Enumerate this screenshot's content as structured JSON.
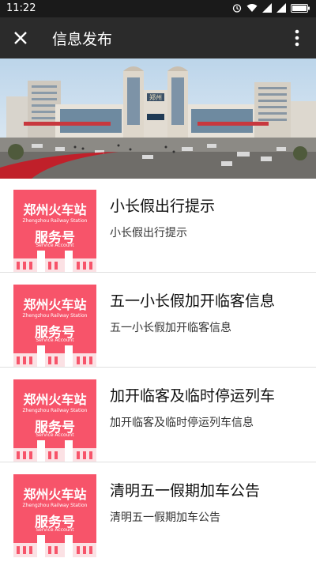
{
  "status_bar": {
    "time": "11:22",
    "icons": [
      "alarm-icon",
      "wifi-icon",
      "signal-icon",
      "signal-icon",
      "battery-icon"
    ]
  },
  "header": {
    "title": "信息发布",
    "left_icon": "close-icon",
    "right_icon": "more-vertical-icon"
  },
  "banner": {
    "sign_text": "郑州"
  },
  "thumb": {
    "title": "郑州火车站",
    "subtitle": "Zhengzhou Railway Station",
    "badge": "服务号",
    "subtitle2": "Service Account",
    "bg_color": "#f7546a"
  },
  "articles": [
    {
      "title": "小长假出行提示",
      "desc": "小长假出行提示"
    },
    {
      "title": "五一小长假加开临客信息",
      "desc": "五一小长假加开临客信息"
    },
    {
      "title": "加开临客及临时停运列车",
      "desc": "加开临客及临时停运列车信息"
    },
    {
      "title": "清明五一假期加车公告",
      "desc": "清明五一假期加车公告"
    }
  ]
}
